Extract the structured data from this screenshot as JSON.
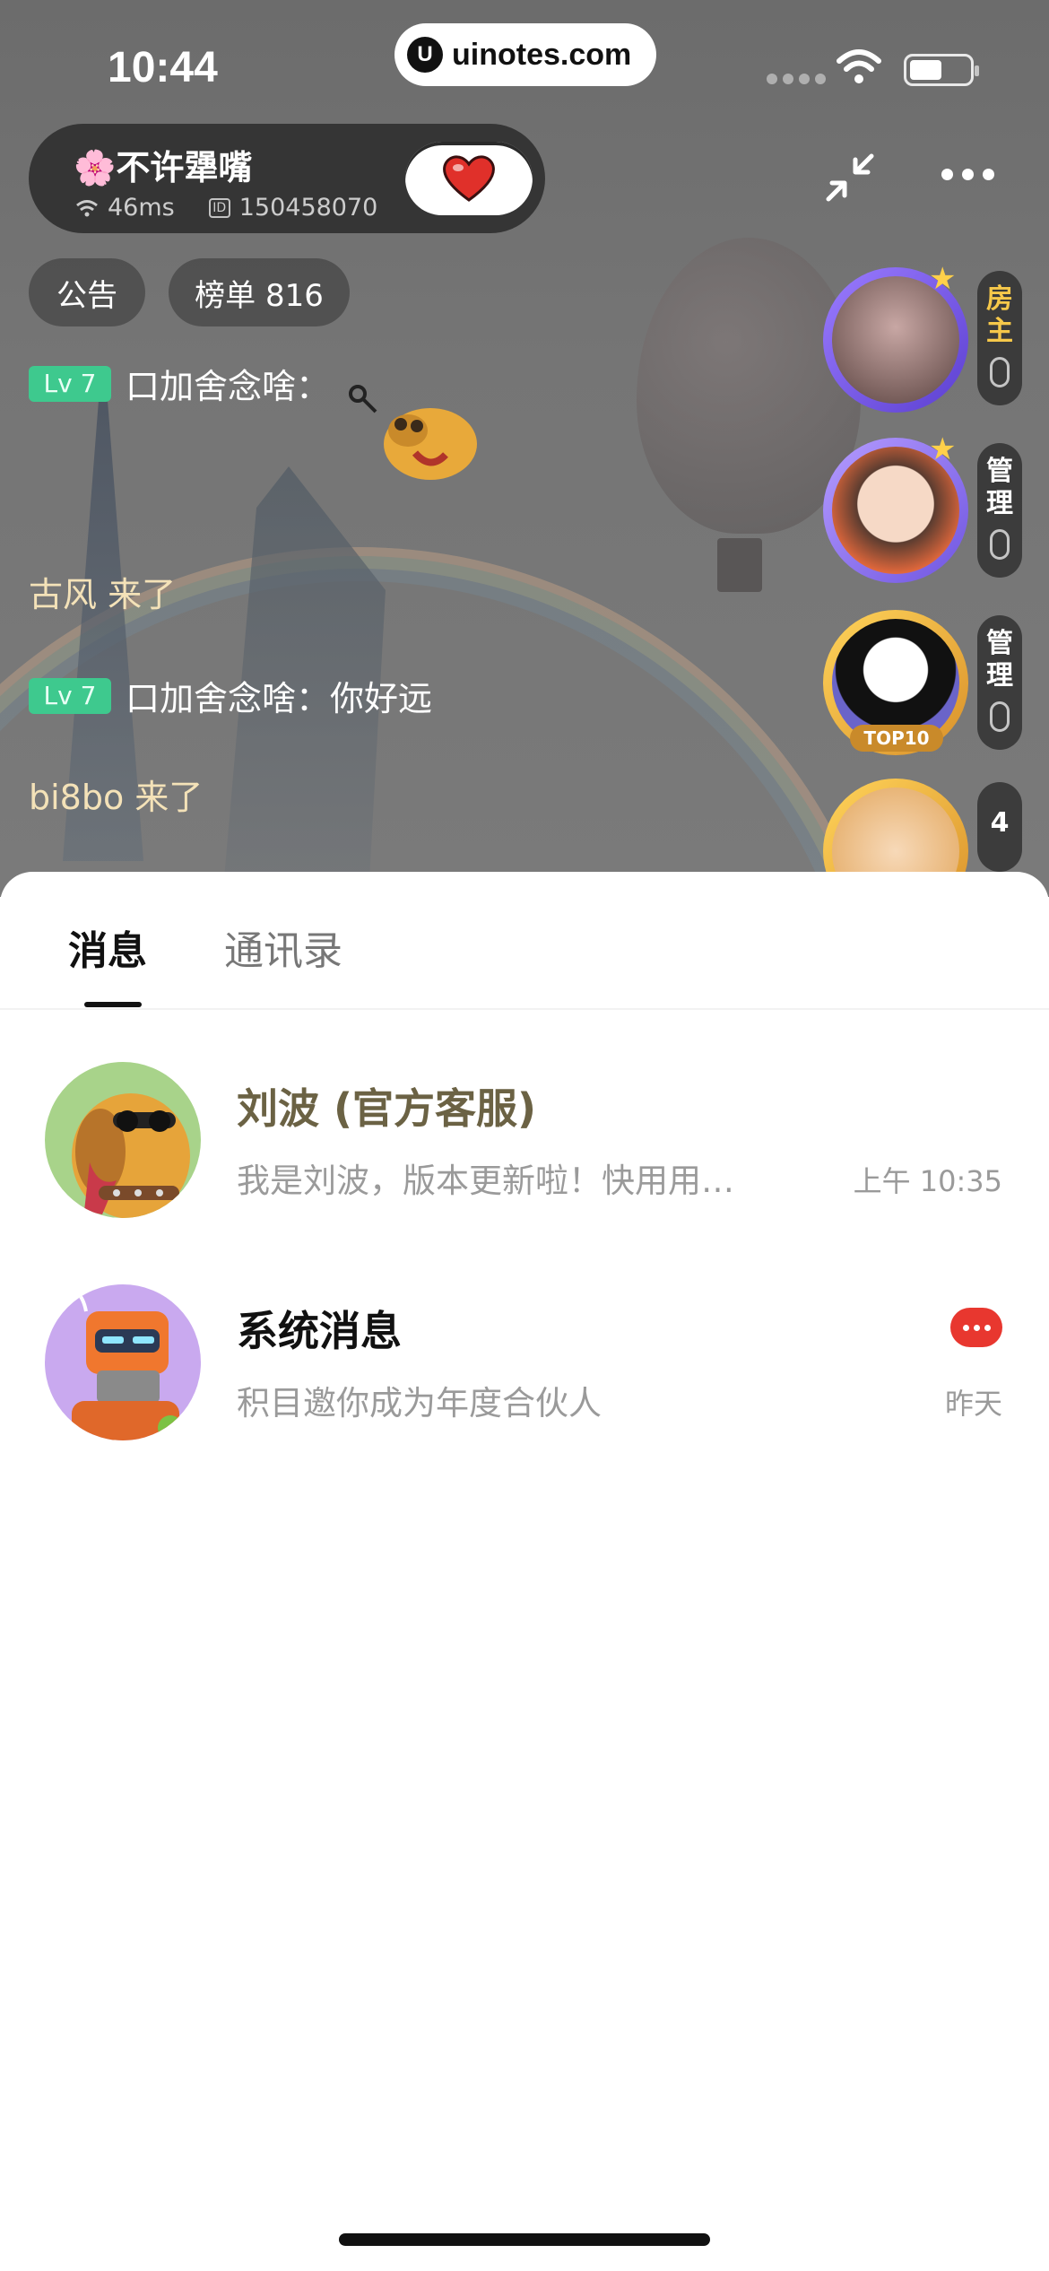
{
  "status_bar": {
    "time": "10:44",
    "url": "uinotes.com"
  },
  "room": {
    "name": "🌸不许犟嘴",
    "ping": "46ms",
    "room_id": "150458070",
    "notice_chip": "公告",
    "rank_chip": "榜单 816"
  },
  "chat": {
    "lines": [
      {
        "level": "Lv 7",
        "text": "口加舍念啥："
      },
      {
        "join": "古风 来了"
      },
      {
        "level": "Lv 7",
        "text": "口加舍念啥：你好远"
      },
      {
        "join": "bi8bo 来了"
      }
    ]
  },
  "seats": [
    {
      "tag": "房主",
      "tag_color": "#f6c84a"
    },
    {
      "tag": "管理",
      "tag_color": "#ffffff"
    },
    {
      "tag": "管理",
      "tag_color": "#ffffff",
      "badge": "TOP10"
    },
    {
      "tag": "4",
      "tag_color": "#ffffff"
    }
  ],
  "sheet": {
    "tabs": [
      {
        "label": "消息",
        "active": true
      },
      {
        "label": "通讯录",
        "active": false
      }
    ],
    "conversations": [
      {
        "name": "刘波 (官方客服)",
        "preview": "我是刘波，版本更新啦！快用用…",
        "time": "上午 10:35",
        "name_color": "#6b6244",
        "avatar_icon": "dog-avatar-icon"
      },
      {
        "name": "系统消息",
        "preview": "积目邀你成为年度合伙人",
        "time": "昨天",
        "name_color": "#111111",
        "avatar_icon": "robot-avatar-icon",
        "has_unread": true
      }
    ]
  },
  "colors": {
    "accent_green": "#3ec98e",
    "unread_red": "#e8372f",
    "join_text": "#f4e2b8"
  }
}
